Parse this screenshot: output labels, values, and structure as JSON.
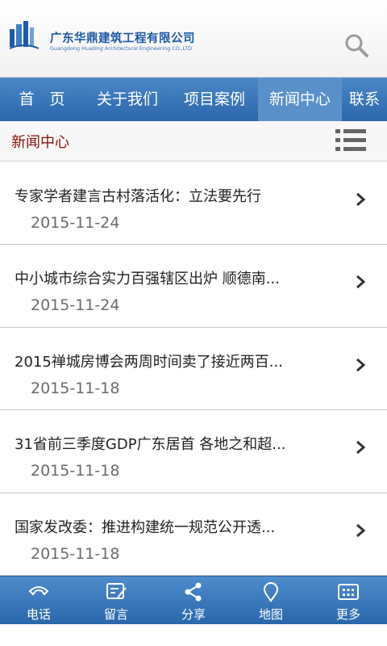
{
  "header": {
    "company_cn": "广东华鼎建筑工程有限公司",
    "company_en": "Guangdong Huading Architectural Engineering CO.,LTD",
    "search_icon": "search-icon"
  },
  "nav": {
    "items": [
      {
        "label": "首　页",
        "active": false
      },
      {
        "label": "关于我们",
        "active": false
      },
      {
        "label": "项目案例",
        "active": false
      },
      {
        "label": "新闻中心",
        "active": true
      },
      {
        "label": "联系",
        "active": false
      }
    ]
  },
  "section": {
    "title": "新闻中心",
    "menu_icon": "list-menu-icon"
  },
  "news": [
    {
      "title": "专家学者建言古村落活化：立法要先行",
      "date": "2015-11-24"
    },
    {
      "title": "中小城市综合实力百强辖区出炉 顺德南...",
      "date": "2015-11-24"
    },
    {
      "title": "2015禅城房博会两周时间卖了接近两百...",
      "date": "2015-11-18"
    },
    {
      "title": "31省前三季度GDP广东居首 各地之和超...",
      "date": "2015-11-18"
    },
    {
      "title": "国家发改委：推进构建统一规范公开透...",
      "date": "2015-11-18"
    }
  ],
  "toolbar": {
    "items": [
      {
        "label": "电话",
        "icon": "phone-icon"
      },
      {
        "label": "留言",
        "icon": "message-icon"
      },
      {
        "label": "分享",
        "icon": "share-icon"
      },
      {
        "label": "地图",
        "icon": "map-pin-icon"
      },
      {
        "label": "更多",
        "icon": "more-icon"
      }
    ]
  },
  "colors": {
    "brand_blue": "#2a66aa",
    "section_title": "#8a1010"
  }
}
